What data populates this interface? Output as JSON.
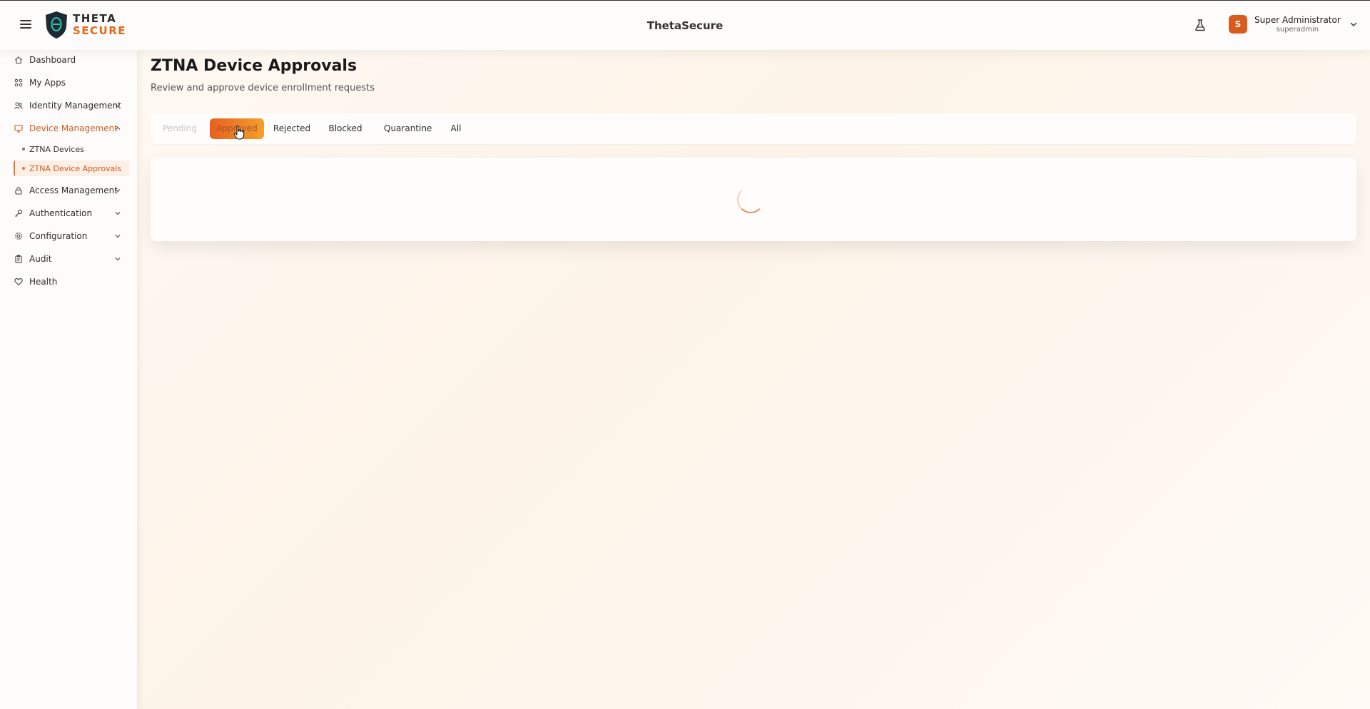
{
  "header": {
    "logo_top": "THETA",
    "logo_bottom": "SECURE",
    "title": "ThetaSecure",
    "user_name": "Super Administrator",
    "user_role": "superadmin",
    "avatar_initial": "S"
  },
  "sidebar": {
    "items": [
      {
        "label": "Dashboard",
        "icon": "home-icon"
      },
      {
        "label": "My Apps",
        "icon": "apps-grid-icon"
      },
      {
        "label": "Identity Management",
        "icon": "users-icon"
      },
      {
        "label": "Device Management",
        "icon": "monitor-icon"
      },
      {
        "label": "Access Management",
        "icon": "lock-icon"
      },
      {
        "label": "Authentication",
        "icon": "key-icon"
      },
      {
        "label": "Configuration",
        "icon": "gear-icon"
      },
      {
        "label": "Audit",
        "icon": "clipboard-icon"
      },
      {
        "label": "Health",
        "icon": "heart-icon"
      }
    ],
    "sub_items": [
      {
        "label": "ZTNA Devices"
      },
      {
        "label": "ZTNA Device Approvals"
      }
    ]
  },
  "main": {
    "title": "ZTNA Device Approvals",
    "subtitle": "Review and approve device enrollment requests",
    "tabs": [
      {
        "label": "Pending"
      },
      {
        "label": "Approved"
      },
      {
        "label": "Rejected"
      },
      {
        "label": "Blocked"
      },
      {
        "label": "Quarantine"
      },
      {
        "label": "All"
      }
    ],
    "active_tab": "Approved"
  },
  "colors": {
    "accent": "#e8661c",
    "active_text": "#d35a1e",
    "logo_dark": "#1e2a33",
    "logo_teal": "#2fc7b0"
  }
}
